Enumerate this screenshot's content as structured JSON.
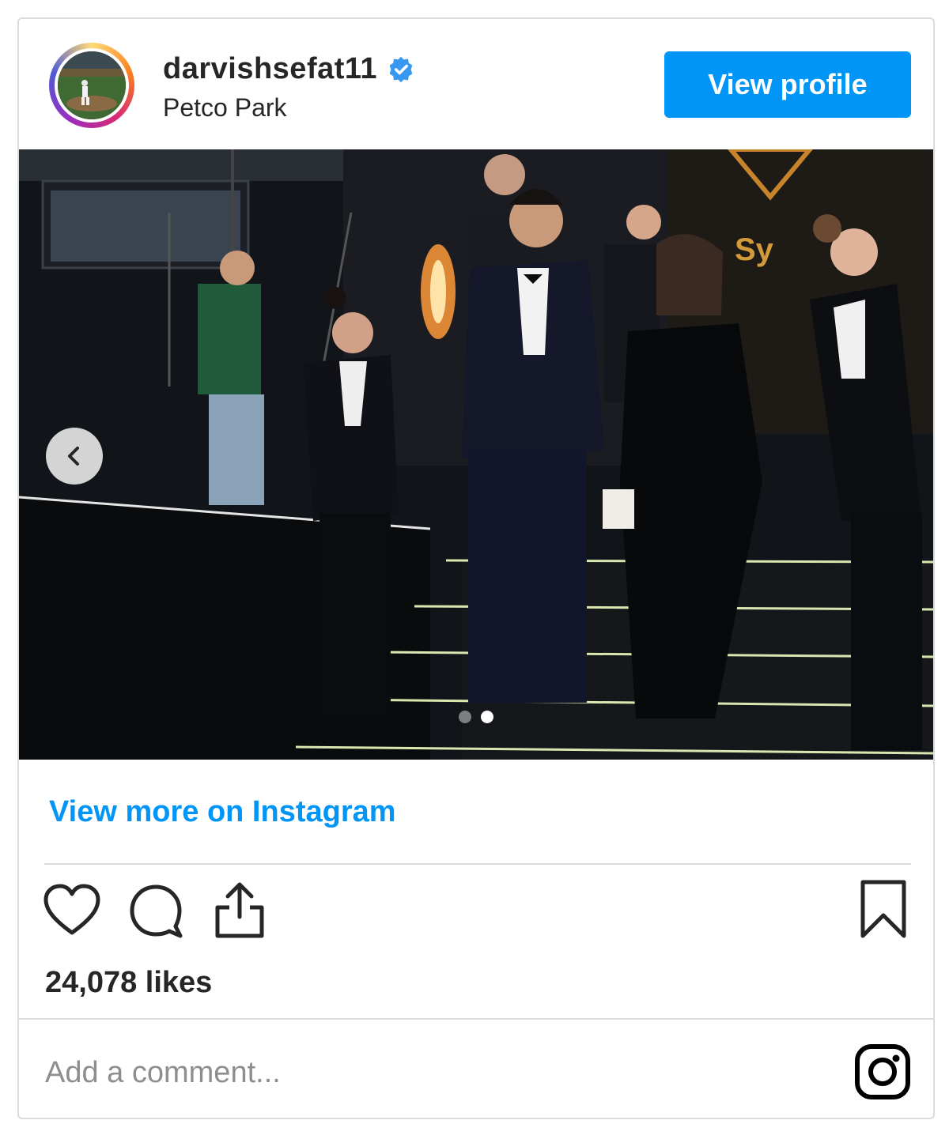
{
  "post": {
    "username": "darvishsefat11",
    "location": "Petco Park",
    "view_profile_label": "View profile",
    "view_more_label": "View more on Instagram",
    "likes_text": "24,078 likes",
    "comment_placeholder": "Add a comment...",
    "carousel": {
      "total_slides": 2,
      "current_slide": 2
    }
  },
  "icons": {
    "verified": "verified-badge-icon",
    "prev": "chevron-left-icon",
    "like": "heart-icon",
    "comment": "comment-bubble-icon",
    "share": "share-icon",
    "save": "bookmark-icon",
    "brand": "instagram-icon"
  },
  "colors": {
    "accent": "#0095f6",
    "verified": "#3897f0",
    "border": "#dbdbdb",
    "muted": "#8e8e8e",
    "text": "#262626"
  }
}
